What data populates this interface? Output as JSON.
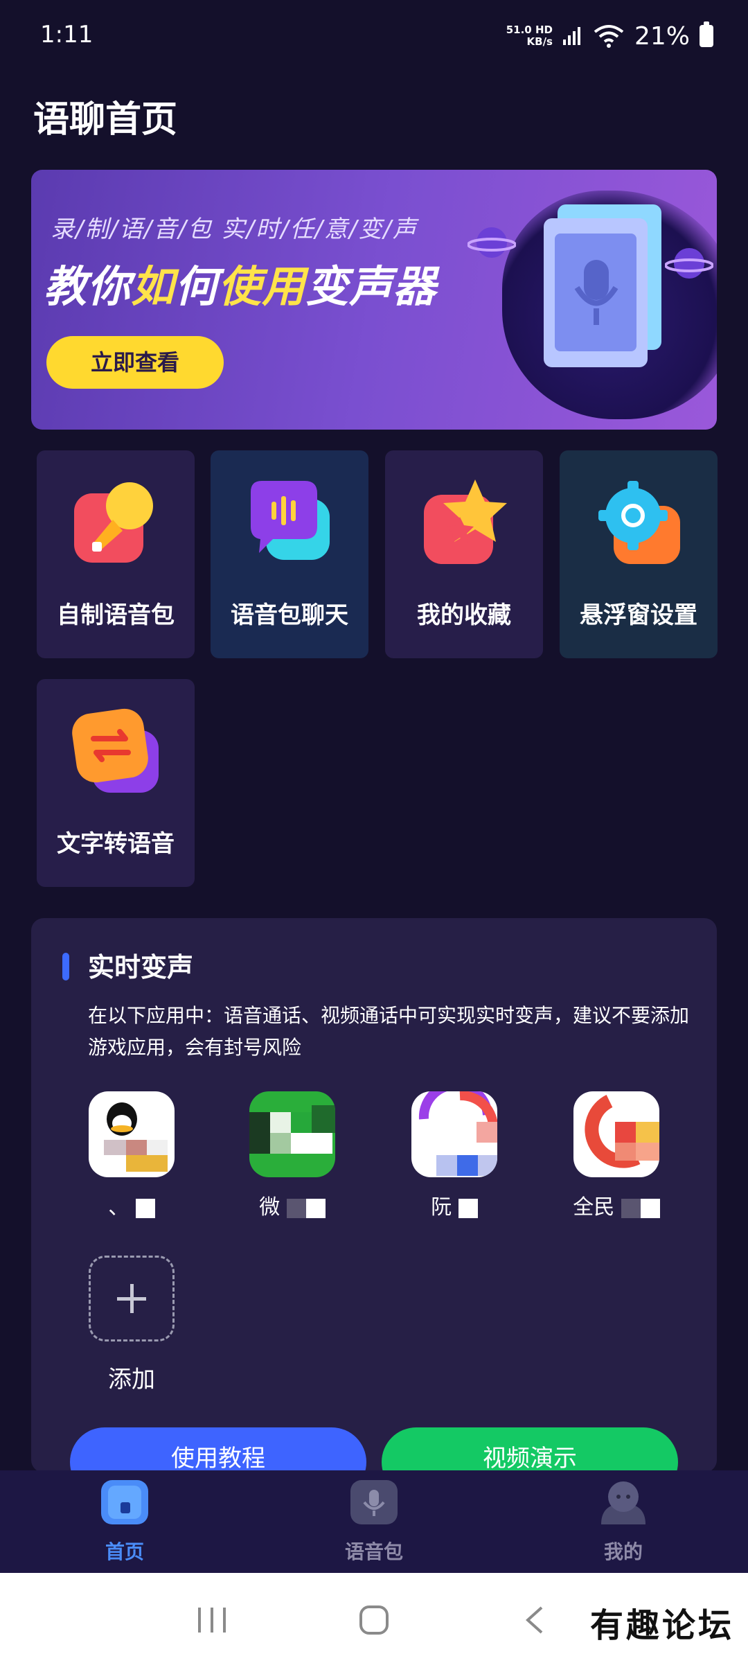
{
  "status_bar": {
    "time": "1:11",
    "net_speed_value": "51.0",
    "net_speed_unit": "KB/s",
    "net_tag": "HD",
    "battery": "21%"
  },
  "page": {
    "title": "语聊首页"
  },
  "banner": {
    "subtitle": "录/制/语/音/包     实/时/任/意/变/声",
    "headline_a": "教你",
    "headline_b": "如",
    "headline_c": "何",
    "headline_d": "使",
    "headline_e": "用",
    "headline_f": "变声器",
    "button": "立即查看"
  },
  "features": [
    {
      "label": "自制语音包",
      "icon": "microphone-icon"
    },
    {
      "label": "语音包聊天",
      "icon": "voice-chat-icon"
    },
    {
      "label": "我的收藏",
      "icon": "star-icon"
    },
    {
      "label": "悬浮窗设置",
      "icon": "gear-icon"
    },
    {
      "label": "文字转语音",
      "icon": "convert-icon"
    }
  ],
  "realtime": {
    "title": "实时变声",
    "description": "在以下应用中：语音通话、视频通话中可实现实时变声，建议不要添加游戏应用，会有封号风险",
    "apps": [
      {
        "name": "、",
        "icon": "qq-icon"
      },
      {
        "name": "微",
        "icon": "wechat-icon"
      },
      {
        "name": "阮",
        "icon": "app-icon"
      },
      {
        "name": "全民",
        "icon": "app-icon"
      }
    ],
    "add_label": "添加",
    "tutorial_button": "使用教程",
    "video_button": "视频演示"
  },
  "bottom_nav": [
    {
      "label": "首页",
      "active": true
    },
    {
      "label": "语音包",
      "active": false
    },
    {
      "label": "我的",
      "active": false
    }
  ],
  "watermark": "有趣论坛",
  "colors": {
    "background": "#14102b",
    "accent_blue": "#3e64ff",
    "accent_green": "#14c964",
    "banner_button": "#ffd92f"
  }
}
